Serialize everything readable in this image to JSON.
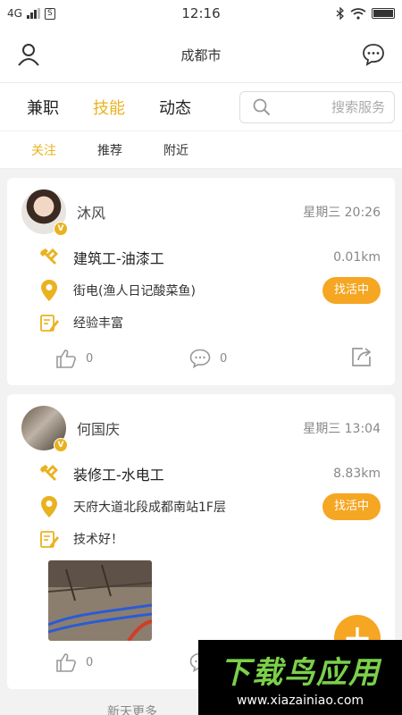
{
  "status_bar": {
    "network": "4G",
    "sim_label": "S",
    "time": "12:16"
  },
  "header": {
    "city": "成都市"
  },
  "tabs": [
    {
      "label": "兼职"
    },
    {
      "label": "技能"
    },
    {
      "label": "动态"
    }
  ],
  "search": {
    "placeholder": "搜索服务"
  },
  "subtabs": [
    {
      "label": "关注"
    },
    {
      "label": "推荐"
    },
    {
      "label": "附近"
    }
  ],
  "posts": [
    {
      "user": "沐风",
      "badge": "V",
      "time": "星期三 20:26",
      "job": "建筑工-油漆工",
      "distance": "0.01km",
      "address": "街电(渔人日记酸菜鱼)",
      "status": "找活中",
      "description": "经验丰富",
      "likes": "0",
      "comments": "0"
    },
    {
      "user": "何国庆",
      "badge": "V",
      "time": "星期三 13:04",
      "job": "装修工-水电工",
      "distance": "8.83km",
      "address": "天府大道北段成都南站1F层",
      "status": "找活中",
      "description": "技术好！",
      "likes": "0"
    }
  ],
  "fab": {
    "label": "+"
  },
  "footer": {
    "more_text": "新天更多"
  },
  "watermark": {
    "title": "下载鸟应用",
    "url": "www.xiazainiao.com"
  },
  "colors": {
    "accent": "#e9b21e",
    "pill": "#f5a623"
  }
}
